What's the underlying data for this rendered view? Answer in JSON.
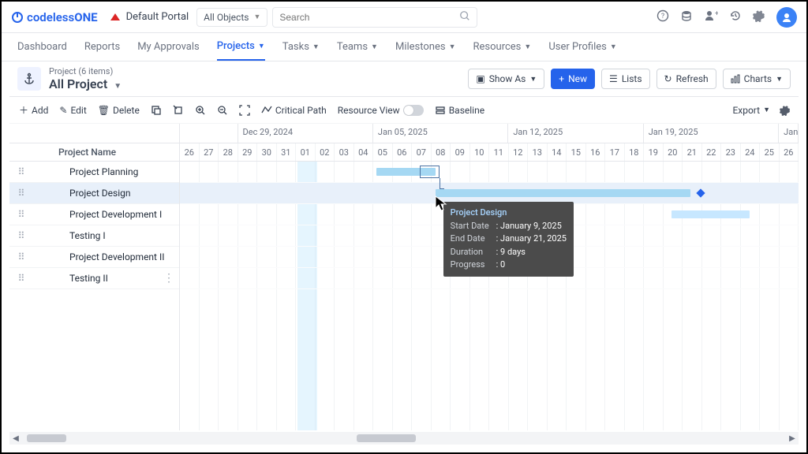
{
  "brand": {
    "name_a": "codeless",
    "name_b": "ONE"
  },
  "portal": "Default Portal",
  "object_selector": "All Objects",
  "search_placeholder": "Search",
  "nav": [
    "Dashboard",
    "Reports",
    "My Approvals",
    "Projects",
    "Tasks",
    "Teams",
    "Milestones",
    "Resources",
    "User Profiles"
  ],
  "nav_has_caret": [
    false,
    false,
    false,
    true,
    true,
    true,
    true,
    true,
    true
  ],
  "nav_active_index": 3,
  "project_count": "Project (6 items)",
  "project_name": "All Project",
  "actions": {
    "show_as": "Show As",
    "new": "New",
    "lists": "Lists",
    "refresh": "Refresh",
    "charts": "Charts"
  },
  "toolbar": {
    "add": "Add",
    "edit": "Edit",
    "delete": "Delete",
    "critical_path": "Critical Path",
    "resource_view": "Resource View",
    "baseline": "Baseline",
    "export": "Export"
  },
  "left_header": "Project Name",
  "rows": [
    {
      "name": "Project Planning"
    },
    {
      "name": "Project Design",
      "highlight": true
    },
    {
      "name": "Project Development I"
    },
    {
      "name": "Testing I"
    },
    {
      "name": "Project Development II"
    },
    {
      "name": "Testing II"
    }
  ],
  "months": [
    "",
    "Dec 29, 2024",
    "Jan 05, 2025",
    "Jan 12, 2025",
    "Jan 19, 2025",
    "Jan"
  ],
  "month_widths": [
    74.7,
    174.3,
    174.3,
    174.3,
    174.3,
    24.9
  ],
  "days": [
    "26",
    "27",
    "28",
    "29",
    "30",
    "31",
    "01",
    "02",
    "03",
    "04",
    "05",
    "06",
    "07",
    "08",
    "09",
    "10",
    "11",
    "12",
    "13",
    "14",
    "15",
    "16",
    "17",
    "18",
    "19",
    "20",
    "21",
    "22",
    "23",
    "24",
    "25",
    "26"
  ],
  "day_width": 24.9,
  "today_index": 6,
  "bars": [
    {
      "row": 0,
      "start": 10,
      "span": 3.0,
      "cls": "plan"
    },
    {
      "row": 1,
      "start": 13,
      "span": 13,
      "cls": "design"
    },
    {
      "row": 2,
      "start": 25,
      "span": 4,
      "cls": "dev"
    }
  ],
  "outline": {
    "row": 0,
    "start": 12.2,
    "span": 1
  },
  "milestone": {
    "row": 1,
    "day": 26.5
  },
  "tooltip": {
    "title": "Project Design",
    "rows": [
      {
        "label": "Start Date",
        "value": "January 9, 2025"
      },
      {
        "label": "End Date",
        "value": "January 21, 2025"
      },
      {
        "label": "Duration",
        "value": "9 days"
      },
      {
        "label": "Progress",
        "value": "0"
      }
    ]
  },
  "chart_data": {
    "type": "gantt",
    "title": "All Project",
    "x_axis": {
      "unit": "days",
      "start": "2024-12-26",
      "end": "2025-01-26",
      "week_headers": [
        "Dec 29, 2024",
        "Jan 05, 2025",
        "Jan 12, 2025",
        "Jan 19, 2025"
      ]
    },
    "tasks": [
      {
        "name": "Project Planning",
        "start": "2025-01-05",
        "end": "2025-01-07"
      },
      {
        "name": "Project Design",
        "start": "2025-01-09",
        "end": "2025-01-21",
        "duration_days": 9,
        "progress": 0
      },
      {
        "name": "Project Development I",
        "start": "2025-01-20",
        "end": "2025-01-23"
      },
      {
        "name": "Testing I"
      },
      {
        "name": "Project Development II"
      },
      {
        "name": "Testing II"
      }
    ],
    "milestones": [
      {
        "task": "Project Design",
        "date": "2025-01-21"
      }
    ],
    "dependencies": [
      {
        "from": "Project Planning",
        "to": "Project Design"
      }
    ],
    "today_marker": "2025-01-01"
  }
}
